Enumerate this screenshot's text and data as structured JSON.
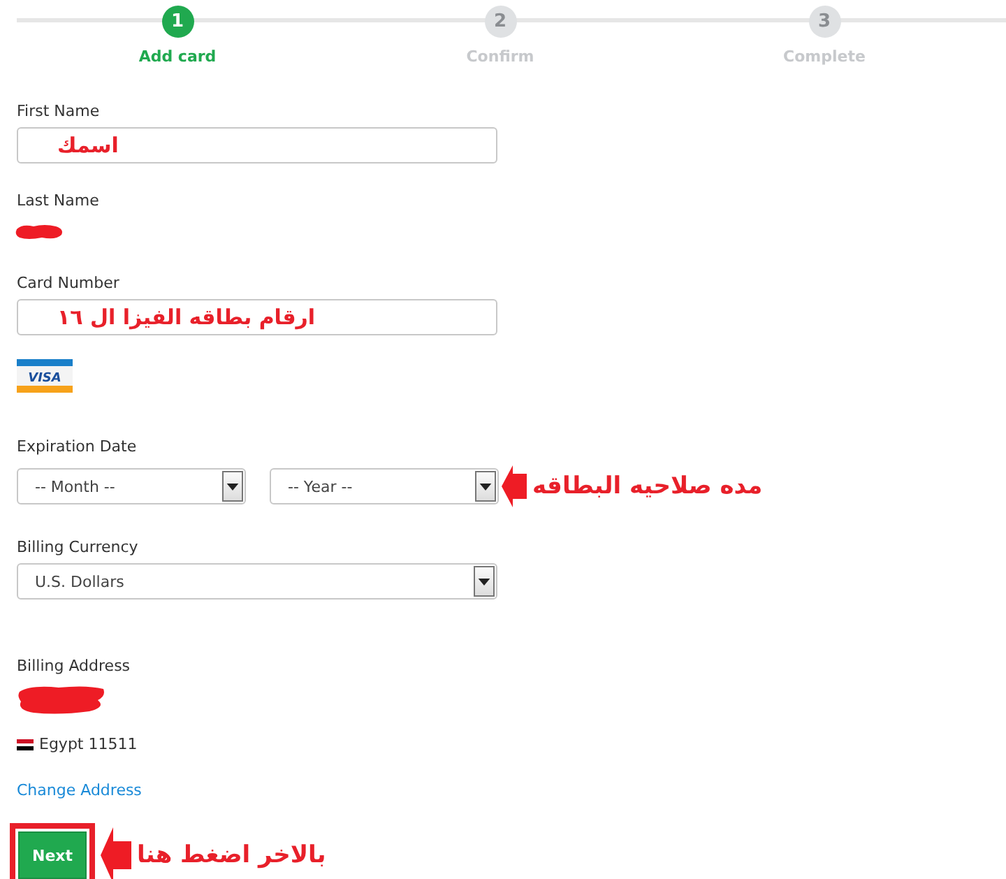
{
  "steps": [
    {
      "number": "1",
      "label": "Add card",
      "selected": true
    },
    {
      "number": "2",
      "label": "Confirm",
      "selected": false
    },
    {
      "number": "3",
      "label": "Complete",
      "selected": false
    }
  ],
  "first_name": {
    "label": "First Name",
    "value": "اسمك"
  },
  "last_name": {
    "label": "Last Name"
  },
  "card_number": {
    "label": "Card Number",
    "value": "ارقام بطاقه الفيزا ال ١٦",
    "brand": "VISA"
  },
  "expiration": {
    "label": "Expiration Date",
    "month": "-- Month --",
    "year": "-- Year --",
    "annotation": "مده صلاحيه البطاقه"
  },
  "billing_currency": {
    "label": "Billing Currency",
    "value": "U.S. Dollars"
  },
  "billing_address": {
    "label": "Billing Address",
    "country": "Egypt 11511",
    "change_link": "Change Address"
  },
  "next": {
    "label": "Next",
    "annotation": "بالاخر اضغط هنا"
  }
}
